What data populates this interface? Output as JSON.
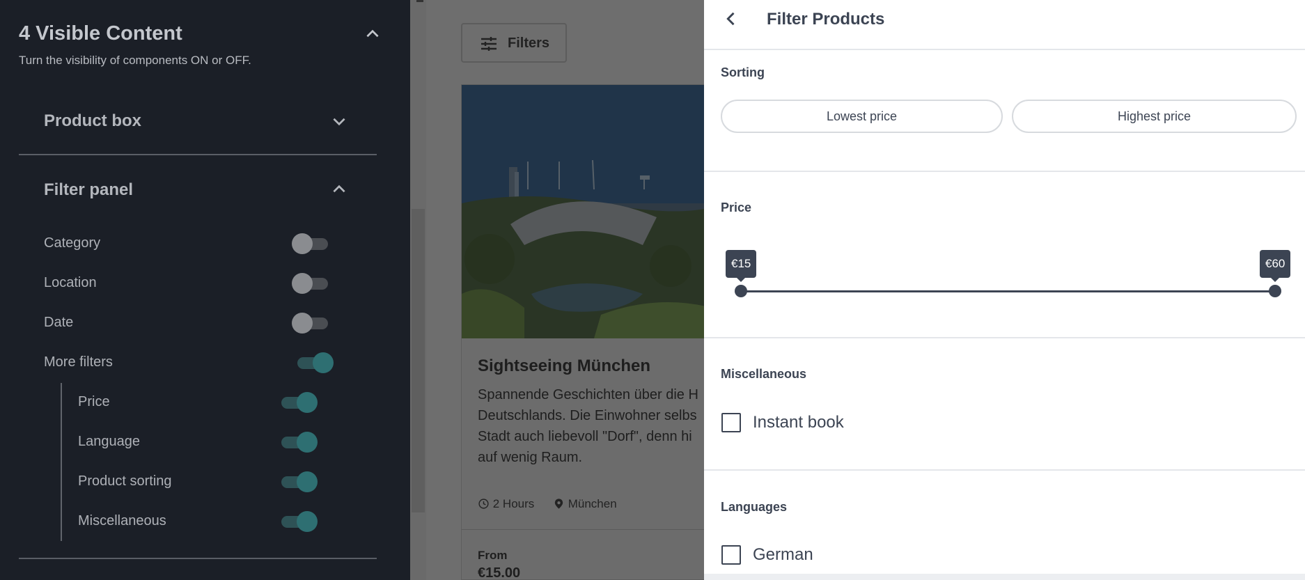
{
  "sidebar": {
    "title": "4 Visible Content",
    "subtitle": "Turn the visibility of components ON or OFF.",
    "sections": [
      {
        "label": "Product box"
      },
      {
        "label": "Filter panel"
      }
    ],
    "filter_items": [
      {
        "label": "Category",
        "on": false
      },
      {
        "label": "Location",
        "on": false
      },
      {
        "label": "Date",
        "on": false
      },
      {
        "label": "More filters",
        "on": true
      }
    ],
    "more_filters_items": [
      {
        "label": "Price",
        "on": true
      },
      {
        "label": "Language",
        "on": true
      },
      {
        "label": "Product sorting",
        "on": true
      },
      {
        "label": "Miscellaneous",
        "on": true
      }
    ]
  },
  "background": {
    "filters_button": "Filters",
    "card": {
      "title": "Sightseeing München",
      "desc_lines": [
        "Spannende Geschichten über die H",
        "Deutschlands. Die Einwohner selbs",
        "Stadt auch liebevoll \"Dorf\", denn hi",
        "auf wenig Raum."
      ],
      "duration": "2 Hours",
      "location": "München",
      "from_label": "From",
      "price": "€15.00"
    }
  },
  "panel": {
    "title": "Filter Products",
    "sorting": {
      "heading": "Sorting",
      "options": [
        "Lowest price",
        "Highest price"
      ]
    },
    "price": {
      "heading": "Price",
      "min_label": "€15",
      "max_label": "€60",
      "min_value": 15,
      "max_value": 60
    },
    "misc": {
      "heading": "Miscellaneous",
      "instant_book": "Instant book"
    },
    "languages": {
      "heading": "Languages",
      "german": "German"
    }
  },
  "colors": {
    "sidebar_bg": "#1b1f27",
    "toggle_on": "#2e6f72",
    "panel_text": "#3c4453",
    "overlay": "#6e6e6e"
  }
}
